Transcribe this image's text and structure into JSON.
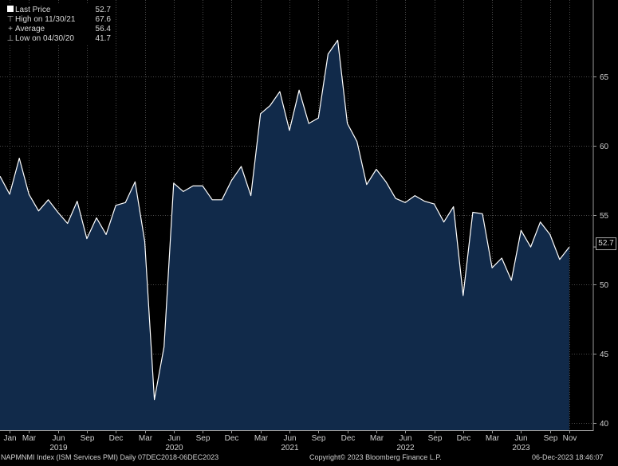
{
  "legend": [
    {
      "key": "swatch",
      "label": "Last Price",
      "value": "52.7"
    },
    {
      "key": "high",
      "label": "High on 11/30/21",
      "value": "67.6"
    },
    {
      "key": "avg",
      "label": "Average",
      "value": "56.4"
    },
    {
      "key": "low",
      "label": "Low on 04/30/20",
      "value": "41.7"
    }
  ],
  "last_value_label": "52.7",
  "footer": {
    "left": "NAPMNMI Index (ISM Services PMI) Daily 07DEC2018-06DEC2023",
    "center": "Copyright© 2023 Bloomberg Finance L.P.",
    "right": "06-Dec-2023 18:46:07"
  },
  "colors": {
    "background": "#000000",
    "area_fill": "#112a4a",
    "line": "#ffffff",
    "grid": "#4a4a4a"
  },
  "chart_data": {
    "type": "area",
    "x": [
      "2018-12",
      "2019-01",
      "2019-02",
      "2019-03",
      "2019-04",
      "2019-05",
      "2019-06",
      "2019-07",
      "2019-08",
      "2019-09",
      "2019-10",
      "2019-11",
      "2019-12",
      "2020-01",
      "2020-02",
      "2020-03",
      "2020-04",
      "2020-05",
      "2020-06",
      "2020-07",
      "2020-08",
      "2020-09",
      "2020-10",
      "2020-11",
      "2020-12",
      "2021-01",
      "2021-02",
      "2021-03",
      "2021-04",
      "2021-05",
      "2021-06",
      "2021-07",
      "2021-08",
      "2021-09",
      "2021-10",
      "2021-11",
      "2021-12",
      "2022-01",
      "2022-02",
      "2022-03",
      "2022-04",
      "2022-05",
      "2022-06",
      "2022-07",
      "2022-08",
      "2022-09",
      "2022-10",
      "2022-11",
      "2022-12",
      "2023-01",
      "2023-02",
      "2023-03",
      "2023-04",
      "2023-05",
      "2023-06",
      "2023-07",
      "2023-08",
      "2023-09",
      "2023-10",
      "2023-11"
    ],
    "values": [
      57.8,
      56.5,
      59.1,
      56.5,
      55.3,
      56.1,
      55.2,
      54.4,
      56.0,
      53.3,
      54.8,
      53.6,
      55.7,
      55.9,
      57.4,
      53.1,
      41.7,
      45.5,
      57.3,
      56.7,
      57.1,
      57.1,
      56.1,
      56.1,
      57.5,
      58.5,
      56.4,
      62.3,
      62.9,
      63.9,
      61.1,
      64.0,
      61.6,
      62.0,
      66.6,
      67.6,
      61.6,
      60.3,
      57.2,
      58.3,
      57.4,
      56.2,
      55.9,
      56.4,
      56.0,
      55.8,
      54.5,
      55.6,
      49.2,
      55.2,
      55.1,
      51.2,
      51.9,
      50.3,
      53.9,
      52.7,
      54.5,
      53.6,
      51.8,
      52.7
    ],
    "ylim": [
      39.5,
      70.5
    ],
    "yticks": [
      40,
      45,
      50,
      55,
      60,
      65
    ],
    "xticks": [
      {
        "label": "Jan",
        "x": "2019-01"
      },
      {
        "label": "Mar",
        "x": "2019-03"
      },
      {
        "label": "Jun",
        "x": "2019-06",
        "year": "2019"
      },
      {
        "label": "Sep",
        "x": "2019-09"
      },
      {
        "label": "Dec",
        "x": "2019-12"
      },
      {
        "label": "Mar",
        "x": "2020-03"
      },
      {
        "label": "Jun",
        "x": "2020-06",
        "year": "2020"
      },
      {
        "label": "Sep",
        "x": "2020-09"
      },
      {
        "label": "Dec",
        "x": "2020-12"
      },
      {
        "label": "Mar",
        "x": "2021-03"
      },
      {
        "label": "Jun",
        "x": "2021-06",
        "year": "2021"
      },
      {
        "label": "Sep",
        "x": "2021-09"
      },
      {
        "label": "Dec",
        "x": "2021-12"
      },
      {
        "label": "Mar",
        "x": "2022-03"
      },
      {
        "label": "Jun",
        "x": "2022-06",
        "year": "2022"
      },
      {
        "label": "Sep",
        "x": "2022-09"
      },
      {
        "label": "Dec",
        "x": "2022-12"
      },
      {
        "label": "Mar",
        "x": "2023-03"
      },
      {
        "label": "Jun",
        "x": "2023-06",
        "year": "2023"
      },
      {
        "label": "Sep",
        "x": "2023-09"
      },
      {
        "label": "Nov",
        "x": "2023-11"
      }
    ],
    "grid": true,
    "legend_position": "top-left"
  }
}
